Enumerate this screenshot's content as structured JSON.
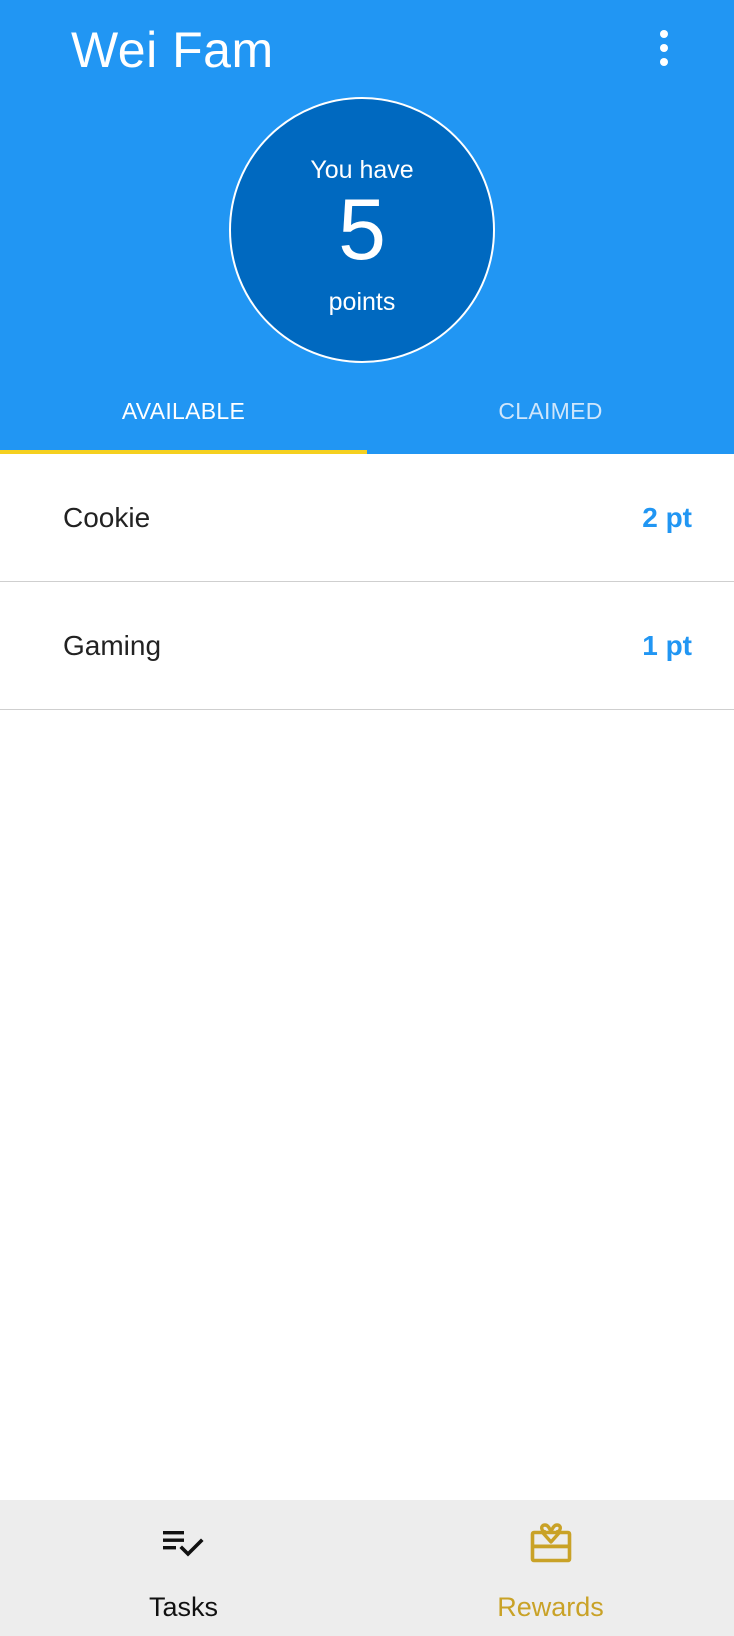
{
  "header": {
    "title": "Wei Fam",
    "menu_icon": "more-vert-icon",
    "points": {
      "prefix": "You have",
      "value": "5",
      "suffix": "points"
    }
  },
  "tabs": [
    {
      "label": "AVAILABLE",
      "active": true
    },
    {
      "label": "CLAIMED",
      "active": false
    }
  ],
  "rewards": [
    {
      "name": "Cookie",
      "cost": "2 pt"
    },
    {
      "name": "Gaming",
      "cost": "1 pt"
    }
  ],
  "bottom_nav": [
    {
      "label": "Tasks",
      "icon": "playlist-check-icon",
      "active": false
    },
    {
      "label": "Rewards",
      "icon": "gift-icon",
      "active": true
    }
  ],
  "colors": {
    "primary": "#2196f3",
    "primary_dark": "#0069c0",
    "tab_indicator": "#f5d020",
    "active_nav": "#c9a227",
    "nav_background": "#ededed"
  }
}
